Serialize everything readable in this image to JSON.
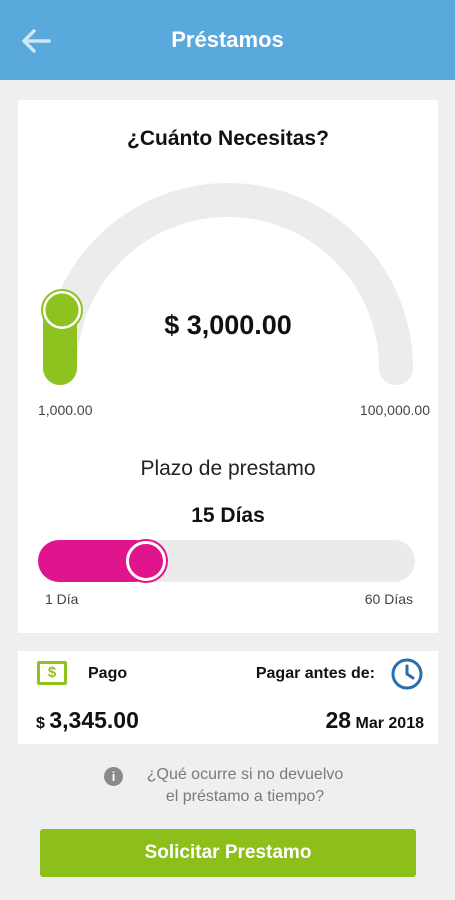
{
  "header": {
    "title": "Préstamos",
    "back_icon": "arrow-left-icon"
  },
  "amount": {
    "question": "¿Cuánto Necesitas?",
    "value": "$ 3,000.00",
    "min_label": "1,000.00",
    "max_label": "100,000.00",
    "min": 1000,
    "max": 100000,
    "current": 3000,
    "color": "#8dc21f"
  },
  "term": {
    "label": "Plazo de prestamo",
    "value": "15 Días",
    "min_label": "1 Día",
    "max_label": "60 Días",
    "min": 1,
    "max": 60,
    "current": 15,
    "color": "#e0148c"
  },
  "payment": {
    "icon": "money-icon",
    "icon_glyph": "$",
    "label": "Pago",
    "currency": "$",
    "amount": "3,345.00",
    "due_label": "Pagar antes de:",
    "due_icon": "clock-icon",
    "due_day": "28",
    "due_month_year": "Mar 2018"
  },
  "info": {
    "icon": "info-icon",
    "icon_glyph": "i",
    "line1": "¿Qué ocurre si no devuelvo",
    "line2": "el préstamo a tiempo?"
  },
  "cta": {
    "label": "Solicitar Prestamo",
    "color": "#8dbf1a"
  }
}
